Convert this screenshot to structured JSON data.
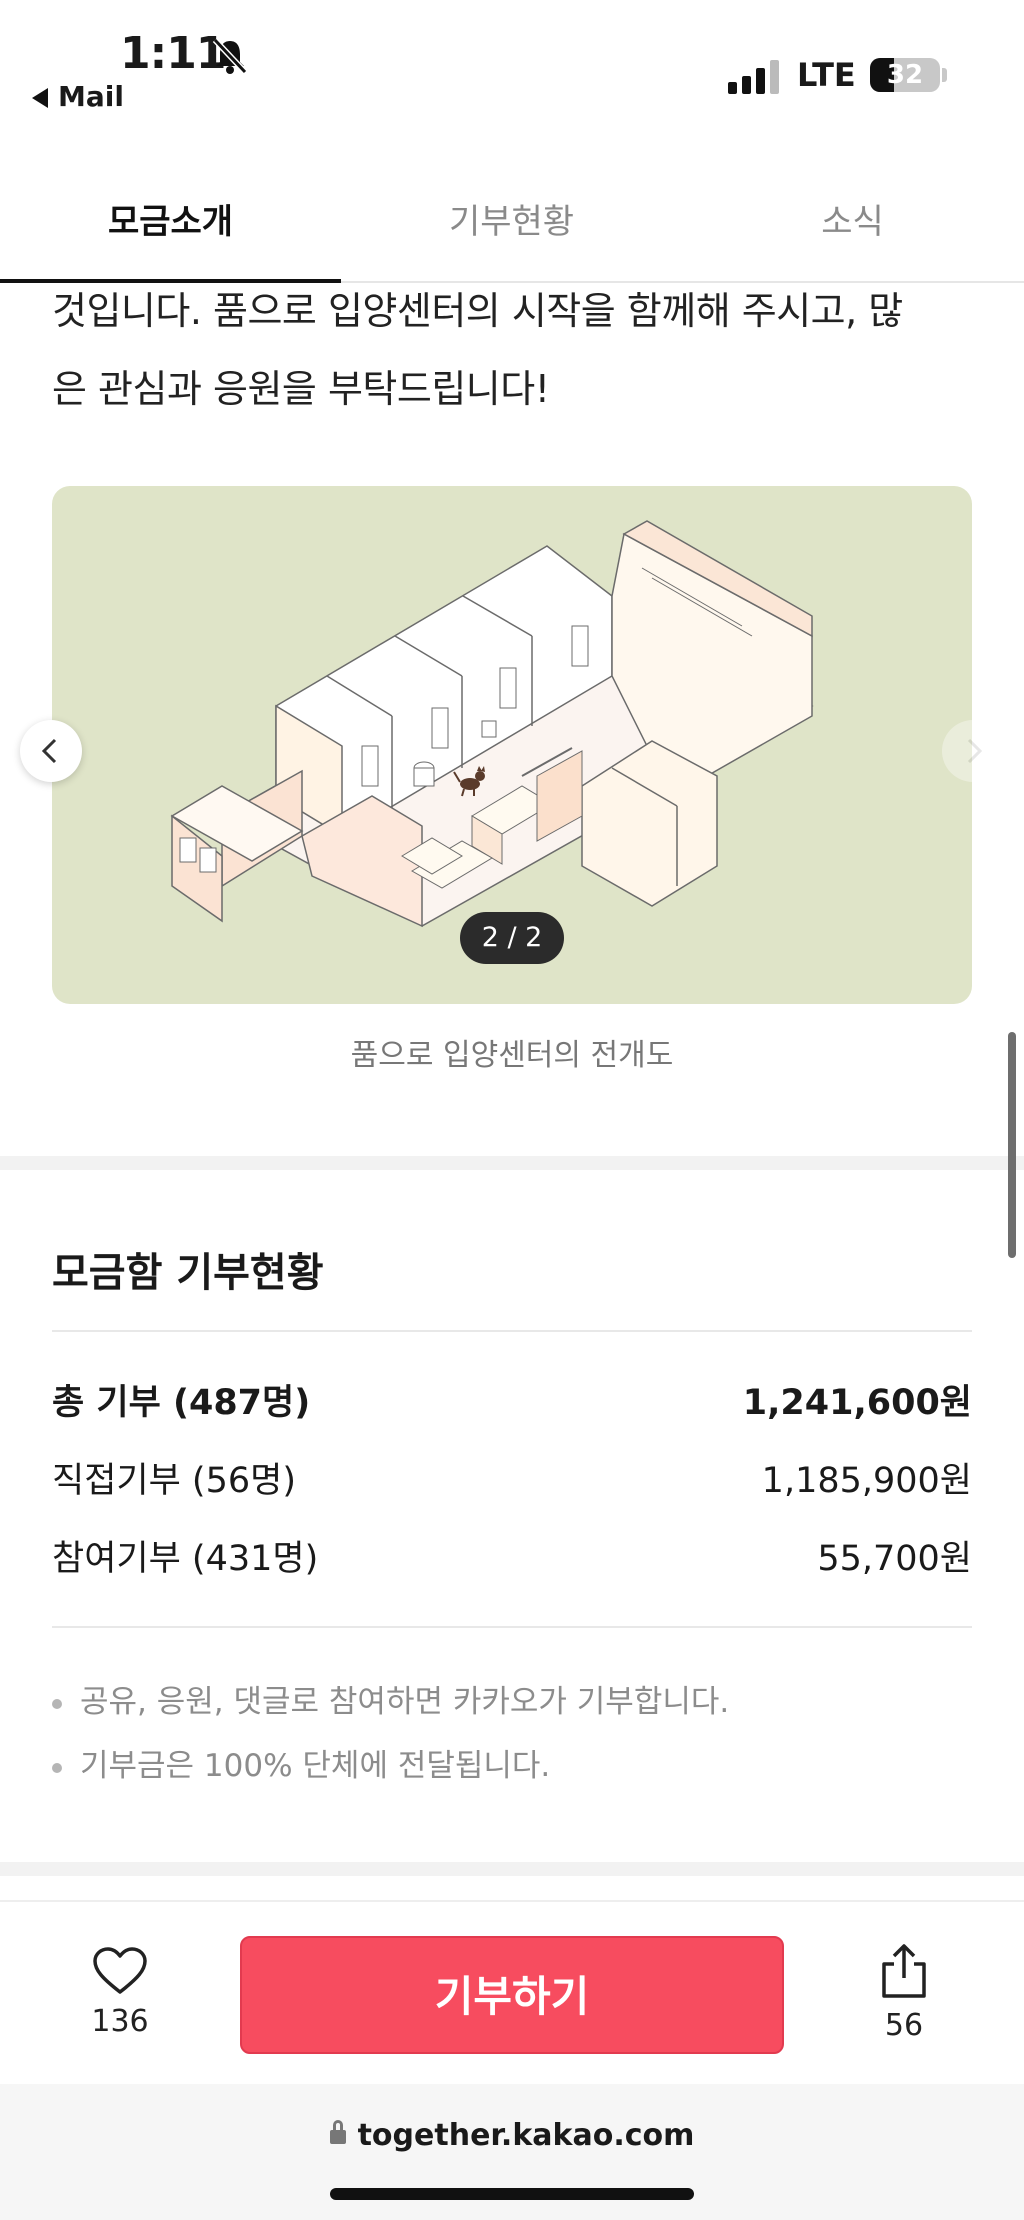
{
  "status_bar": {
    "time": "1:11",
    "back_app": "Mail",
    "network": "LTE",
    "battery": "32"
  },
  "tabs": [
    {
      "label": "모금소개",
      "active": true
    },
    {
      "label": "기부현황",
      "active": false
    },
    {
      "label": "소식",
      "active": false
    }
  ],
  "intro": {
    "line1": "것입니다. 품으로 입양센터의 시작을 함께해 주시고, 많",
    "line2": "은 관심과 응원을 부탁드립니다!"
  },
  "carousel": {
    "counter": "2 / 2",
    "caption": "품으로 입양센터의 전개도"
  },
  "donation": {
    "title": "모금함 기부현황",
    "rows": [
      {
        "label": "총 기부 (487명)",
        "amount": "1,241,600원"
      },
      {
        "label": "직접기부 (56명)",
        "amount": "1,185,900원"
      },
      {
        "label": "참여기부 (431명)",
        "amount": "55,700원"
      }
    ],
    "notes": [
      "공유, 응원, 댓글로 참여하면 카카오가 기부합니다.",
      "기부금은 100% 단체에 전달됩니다."
    ]
  },
  "action_bar": {
    "like_count": "136",
    "donate_label": "기부하기",
    "share_count": "56"
  },
  "url_bar": {
    "url": "together.kakao.com"
  },
  "colors": {
    "accent": "#f74c5f",
    "image_bg": "#dfe4c8"
  }
}
